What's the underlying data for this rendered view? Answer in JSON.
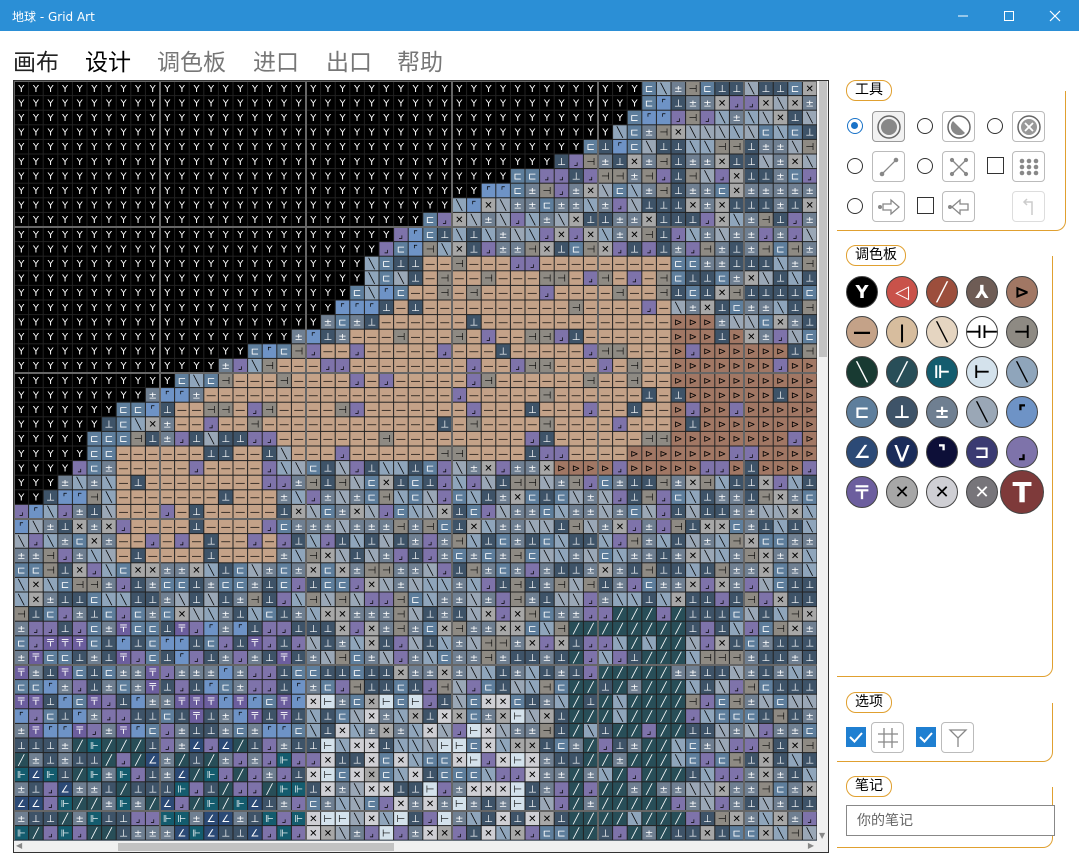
{
  "window": {
    "title": "地球 - Grid Art"
  },
  "menu": [
    {
      "label": "画布",
      "active": false
    },
    {
      "label": "设计",
      "active": true
    },
    {
      "label": "调色板",
      "active": false
    },
    {
      "label": "进口",
      "active": false
    },
    {
      "label": "出口",
      "active": false
    },
    {
      "label": "帮助",
      "active": false
    }
  ],
  "tools": {
    "label": "工具",
    "items": [
      {
        "name": "fill-tool",
        "icon": "filled-circle",
        "control": "radio",
        "selected": true
      },
      {
        "name": "half-tool",
        "icon": "half-circle",
        "control": "radio",
        "selected": false
      },
      {
        "name": "erase-tool",
        "icon": "circle-x",
        "control": "radio",
        "selected": false
      },
      {
        "name": "line-tool",
        "icon": "line-segment",
        "control": "radio",
        "selected": false
      },
      {
        "name": "cross-line-tool",
        "icon": "cross-line",
        "control": "radio",
        "selected": false
      },
      {
        "name": "pattern-tool",
        "icon": "dot-grid",
        "control": "checkbox",
        "selected": false
      },
      {
        "name": "shift-right-tool",
        "icon": "arrow-right",
        "control": "radio",
        "selected": false
      },
      {
        "name": "shift-left-tool",
        "icon": "arrow-left",
        "control": "checkbox",
        "selected": false
      },
      {
        "name": "undo-tool",
        "icon": "undo-arrow",
        "control": "none",
        "selected": false
      }
    ]
  },
  "palette": {
    "label": "调色板",
    "colors": [
      {
        "hex": "#000000",
        "glyph": "Y",
        "fg": "#ffffff"
      },
      {
        "hex": "#c9524a",
        "glyph": "◁",
        "fg": "#ffffff"
      },
      {
        "hex": "#9c4e3c",
        "glyph": "╱",
        "fg": "#ffffff"
      },
      {
        "hex": "#6e5c55",
        "glyph": "⅄",
        "fg": "#ffffff"
      },
      {
        "hex": "#a17764",
        "glyph": "⊳",
        "fg": "#000000"
      },
      {
        "hex": "#c4a288",
        "glyph": "—",
        "fg": "#000000"
      },
      {
        "hex": "#d7bd9e",
        "glyph": "|",
        "fg": "#000000"
      },
      {
        "hex": "#e5d5c1",
        "glyph": "╲",
        "fg": "#000000"
      },
      {
        "hex": "#ffffff",
        "glyph": "⊣⊢",
        "fg": "#000000"
      },
      {
        "hex": "#8e8a83",
        "glyph": "⊣",
        "fg": "#000000"
      },
      {
        "hex": "#183a32",
        "glyph": "╲",
        "fg": "#ffffff"
      },
      {
        "hex": "#284e58",
        "glyph": "╱",
        "fg": "#ffffff"
      },
      {
        "hex": "#145c6e",
        "glyph": "⊩",
        "fg": "#ffffff"
      },
      {
        "hex": "#d4e2ec",
        "glyph": "⊢",
        "fg": "#000000"
      },
      {
        "hex": "#8fa5bb",
        "glyph": "╲",
        "fg": "#000000"
      },
      {
        "hex": "#5e7e9c",
        "glyph": "⊏",
        "fg": "#ffffff"
      },
      {
        "hex": "#3e5368",
        "glyph": "⊥",
        "fg": "#ffffff"
      },
      {
        "hex": "#6f7f91",
        "glyph": "±",
        "fg": "#ffffff"
      },
      {
        "hex": "#9aa7b6",
        "glyph": "╲",
        "fg": "#000000"
      },
      {
        "hex": "#6e93c6",
        "glyph": "⌜",
        "fg": "#000000"
      },
      {
        "hex": "#2c4a76",
        "glyph": "∠",
        "fg": "#ffffff"
      },
      {
        "hex": "#1a2c5a",
        "glyph": "⋁",
        "fg": "#ffffff"
      },
      {
        "hex": "#0d0f38",
        "glyph": "⌝",
        "fg": "#ffffff"
      },
      {
        "hex": "#3a3a72",
        "glyph": "⊐",
        "fg": "#ffffff"
      },
      {
        "hex": "#7e73aa",
        "glyph": "⌟",
        "fg": "#000000"
      },
      {
        "hex": "#6c5e9e",
        "glyph": "〒",
        "fg": "#ffffff"
      },
      {
        "hex": "#a7a7a7",
        "glyph": "✕",
        "fg": "#000000"
      },
      {
        "hex": "#cfcfd4",
        "glyph": "✕",
        "fg": "#000000"
      },
      {
        "hex": "#77757a",
        "glyph": "✕",
        "fg": "#ffffff"
      },
      {
        "hex": "#7e3a3a",
        "glyph": "T",
        "fg": "#ffffff",
        "selected": true
      }
    ]
  },
  "options": {
    "label": "选项",
    "items": [
      {
        "name": "show-grid",
        "checked": true,
        "icon": "grid-hash"
      },
      {
        "name": "show-symbols",
        "checked": true,
        "icon": "symbol-y"
      }
    ]
  },
  "notes": {
    "label": "笔记",
    "placeholder": "你的笔记",
    "value": ""
  },
  "colors": {
    "titlebar": "#2b8fd6",
    "accent": "#e0a030",
    "check": "#1f7fd1"
  }
}
